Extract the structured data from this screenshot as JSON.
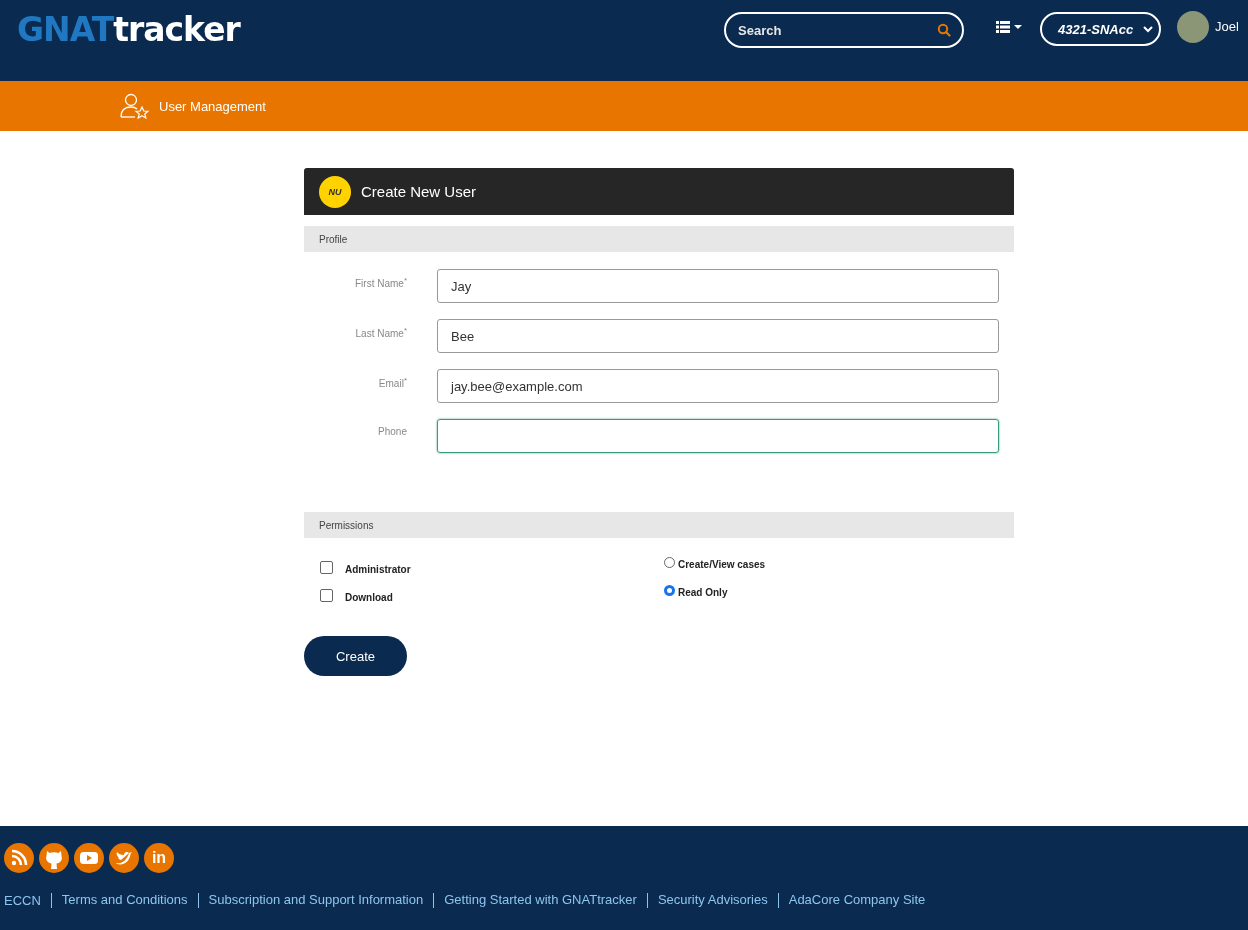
{
  "header": {
    "logo": {
      "part1": "GNAT",
      "part2": "tracker"
    },
    "search": {
      "placeholder": "Search"
    },
    "account_select": {
      "value": "4321-SNAcc"
    },
    "user": {
      "name": "Joel"
    }
  },
  "nav": {
    "items": [
      {
        "label": "User Management"
      }
    ]
  },
  "form": {
    "badge": "NU",
    "title": "Create New User",
    "profile": {
      "heading": "Profile",
      "fields": [
        {
          "label": "First Name$^{*}$",
          "value": "Jay",
          "focused": false
        },
        {
          "label": "Last Name$^{*}$",
          "value": "Bee",
          "focused": false
        },
        {
          "label": "Email$^{*}$",
          "value": "jay.bee@example.com",
          "focused": false
        },
        {
          "label": "Phone",
          "focused": true
        }
      ]
    },
    "permissions": {
      "heading": "Permissions",
      "checkboxes": [
        {
          "label": "Administrator",
          "checked": false
        },
        {
          "label": "Download",
          "checked": false
        }
      ],
      "radios": [
        {
          "label": "Create/View cases",
          "selected": false
        },
        {
          "label": "Read Only",
          "selected": true
        }
      ]
    },
    "submit": "Create"
  },
  "footer": {
    "social": [
      {
        "kind": "rss"
      },
      {
        "kind": "github"
      },
      {
        "kind": "youtube"
      },
      {
        "kind": "twitter"
      },
      {
        "kind": "linkedin",
        "glyph": "in"
      }
    ],
    "links": [
      "ECCN",
      "Terms and Conditions",
      "Subscription and Support Information",
      "Getting Started with GNATtracker",
      "Security Advisories",
      "AdaCore Company Site"
    ]
  }
}
